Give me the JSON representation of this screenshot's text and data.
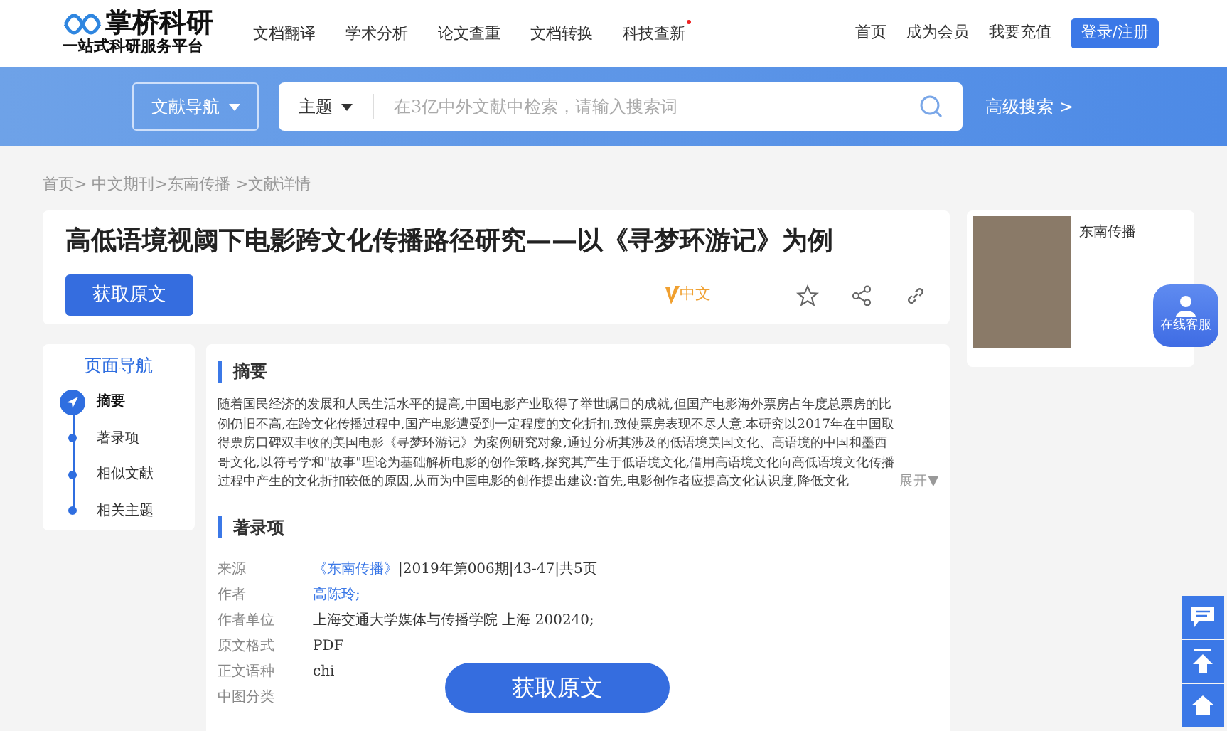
{
  "header": {
    "logo_title": "掌桥科研",
    "logo_subtitle": "一站式科研服务平台",
    "nav": [
      {
        "label": "文档翻译",
        "dot": false
      },
      {
        "label": "学术分析",
        "dot": false
      },
      {
        "label": "论文查重",
        "dot": false
      },
      {
        "label": "文档转换",
        "dot": false
      },
      {
        "label": "科技查新",
        "dot": true
      }
    ],
    "right_links": [
      "首页",
      "成为会员",
      "我要充值"
    ],
    "login": "登录/注册"
  },
  "search": {
    "nav_button": "文献导航",
    "scope": "主题",
    "placeholder": "在3亿中外文献中检索，请输入搜索词",
    "advanced": "高级搜索 >"
  },
  "breadcrumb": "首页> 中文期刊>东南传播 >文献详情",
  "article": {
    "title": "高低语境视阈下电影跨文化传播路径研究——以《寻梦环游记》为例",
    "get_button": "获取原文",
    "lang_badge": "中文"
  },
  "journal": {
    "name": "东南传播"
  },
  "page_nav": {
    "title": "页面导航",
    "items": [
      {
        "label": "摘要",
        "selected": true
      },
      {
        "label": "著录项",
        "selected": false
      },
      {
        "label": "相似文献",
        "selected": false
      },
      {
        "label": "相关主题",
        "selected": false
      }
    ]
  },
  "abstract": {
    "heading": "摘要",
    "text": "随着国民经济的发展和人民生活水平的提高,中国电影产业取得了举世瞩目的成就,但国产电影海外票房占年度总票房的比例仍旧不高,在跨文化传播过程中,国产电影遭受到一定程度的文化折扣,致使票房表现不尽人意.本研究以2017年在中国取得票房口碑双丰收的美国电影《寻梦环游记》为案例研究对象,通过分析其涉及的低语境美国文化、高语境的中国和墨西哥文化,以符号学和\"故事\"理论为基础解析电影的创作策略,探究其产生于低语境文化,借用高语境文化向高低语境文化传播过程中产生的文化折扣较低的原因,从而为中国电影的创作提出建议:首先,电影创作者应提高文化认识度,降低文化",
    "expand": "展开▼"
  },
  "record": {
    "heading": "著录项",
    "rows": [
      {
        "label": "来源",
        "kind": "source",
        "link": "《东南传播》",
        "value": "|2019年第006期|43-47|共5页"
      },
      {
        "label": "作者",
        "kind": "link",
        "link": "高陈玲;"
      },
      {
        "label": "作者单位",
        "kind": "text",
        "value": "上海交通大学媒体与传播学院 上海 200240;"
      },
      {
        "label": "原文格式",
        "kind": "text",
        "value": "PDF"
      },
      {
        "label": "正文语种",
        "kind": "text",
        "value": "chi"
      },
      {
        "label": "中图分类",
        "kind": "text"
      }
    ]
  },
  "floating_get": "获取原文",
  "service": "在线客服"
}
